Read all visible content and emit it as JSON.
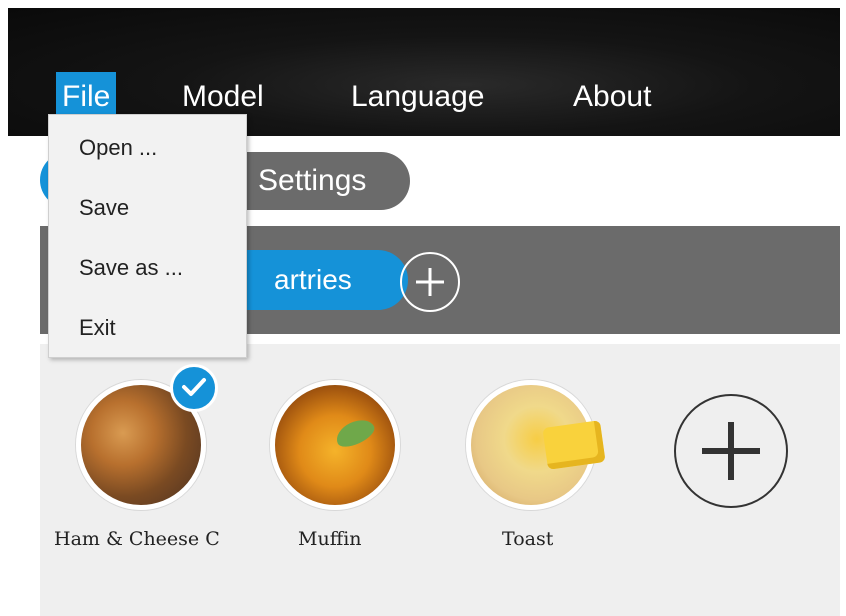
{
  "menubar": {
    "items": [
      {
        "label": "File"
      },
      {
        "label": "Model"
      },
      {
        "label": "Language"
      },
      {
        "label": "About"
      }
    ],
    "active_color": "#1592d8"
  },
  "file_menu": {
    "items": [
      {
        "label": "Open ..."
      },
      {
        "label": "Save"
      },
      {
        "label": "Save as ..."
      },
      {
        "label": "Exit"
      }
    ]
  },
  "tabs": {
    "settings_label": "Settings"
  },
  "category_bar": {
    "active_chip_label": "artries"
  },
  "recipes": [
    {
      "name": "Ham & Cheese C",
      "selected": true,
      "icon": "croissant-image"
    },
    {
      "name": "Muffin",
      "selected": false,
      "icon": "muffin-image"
    },
    {
      "name": "Toast",
      "selected": false,
      "icon": "toast-image"
    }
  ],
  "colors": {
    "accent": "#1592d8",
    "bar_gray": "#6b6b6b",
    "content_bg": "#efefef"
  }
}
